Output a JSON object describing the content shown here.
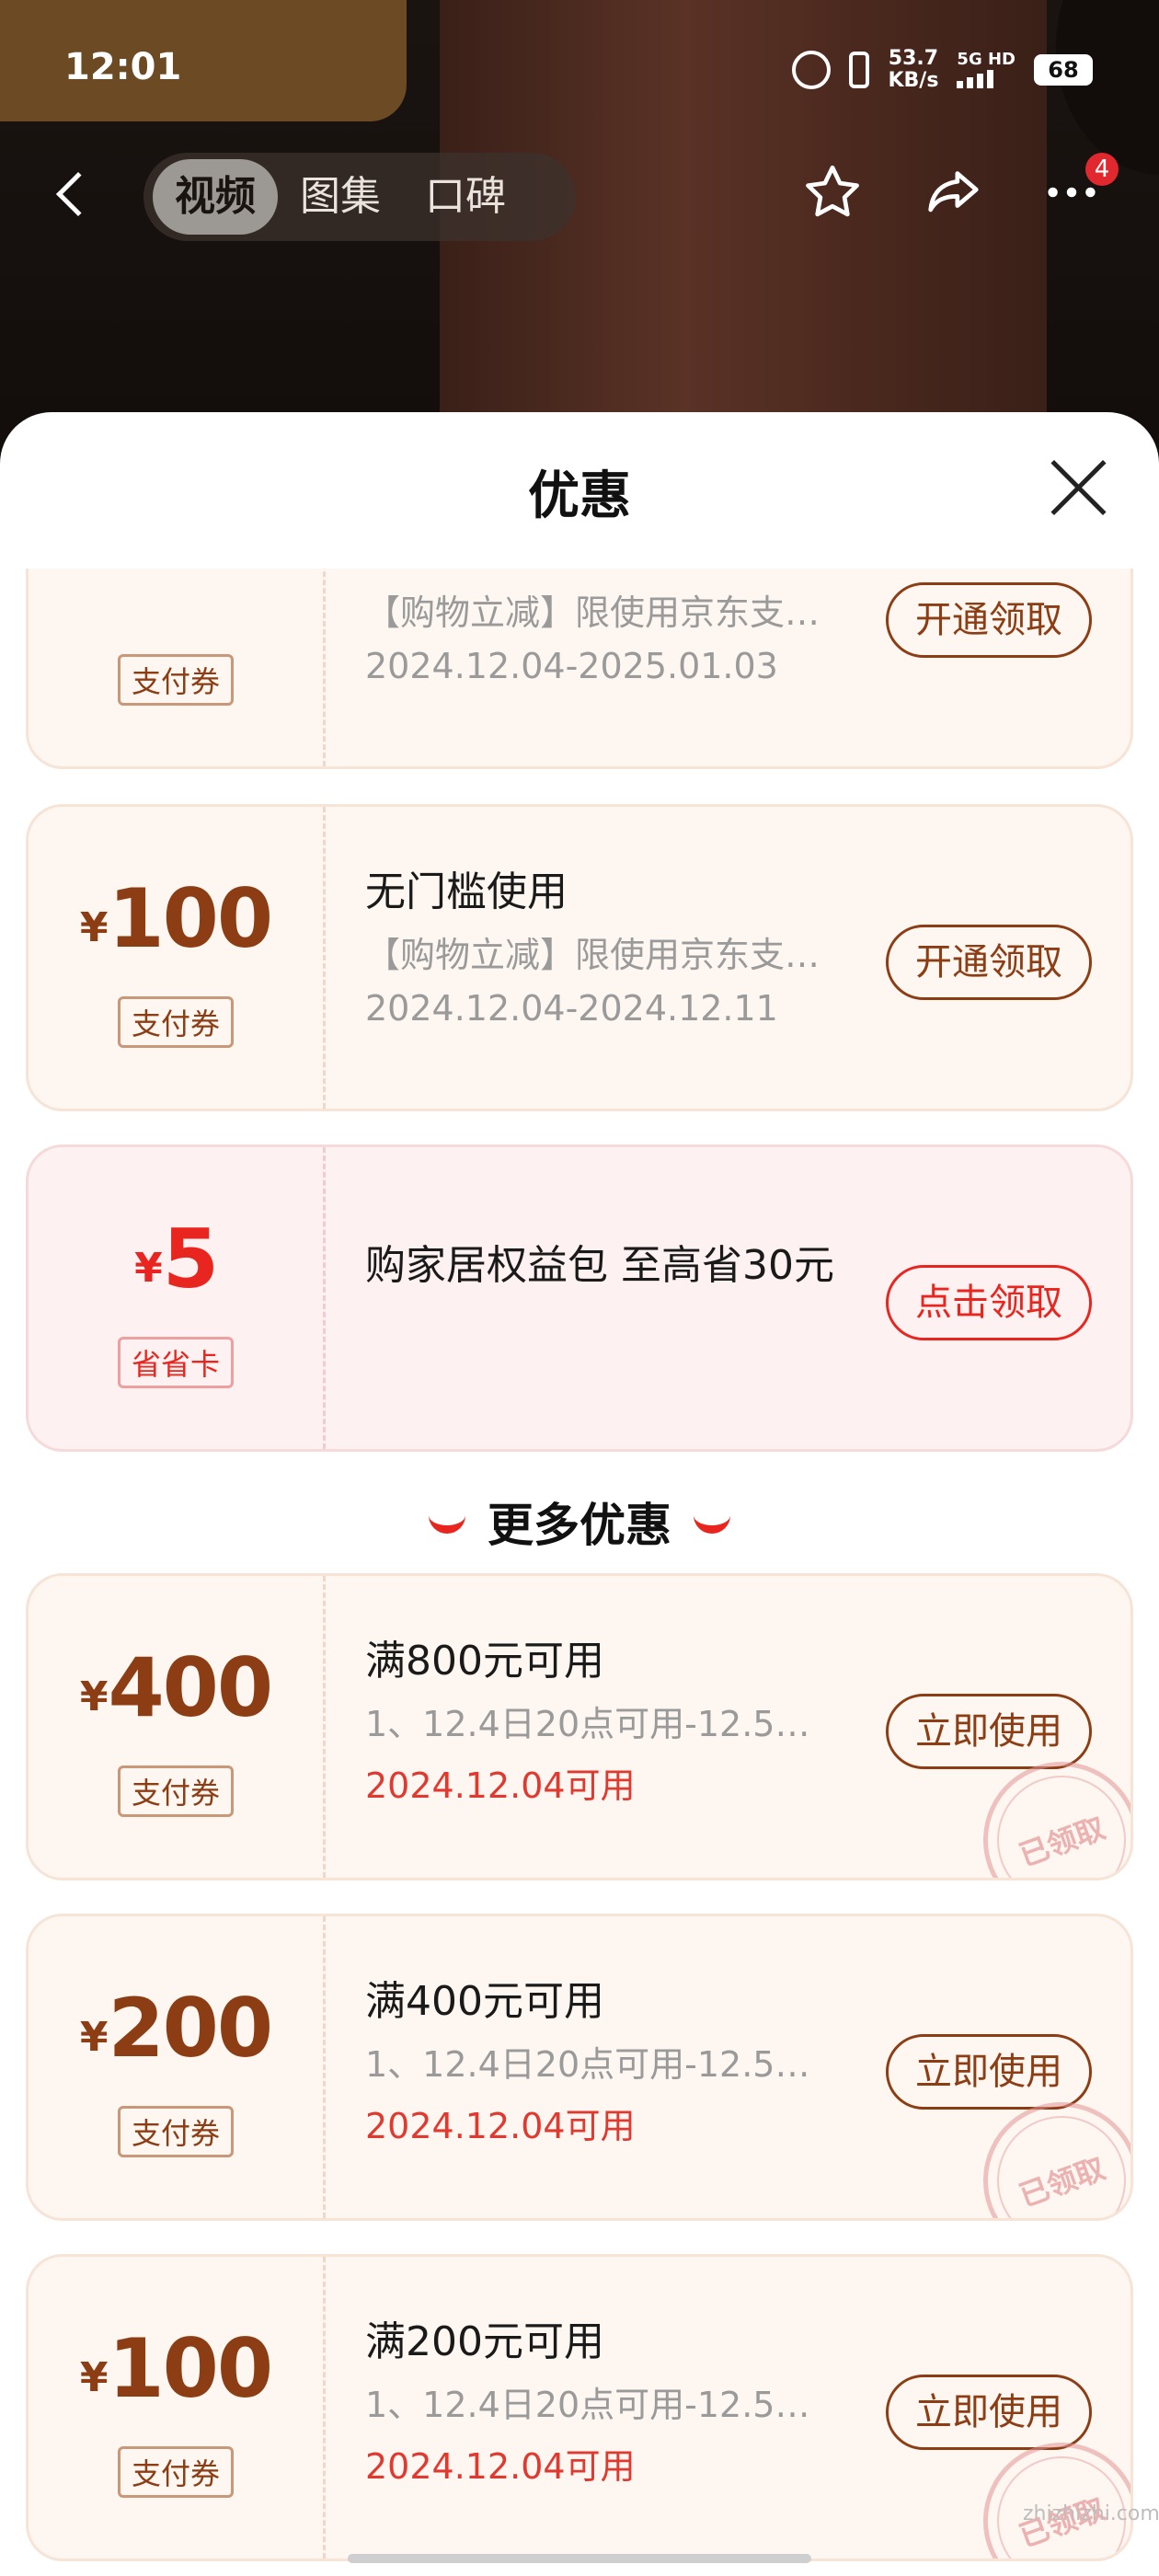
{
  "status_bar": {
    "time": "12:01",
    "net_speed": "53.7",
    "net_unit": "KB/s",
    "net_type": "5G HD",
    "battery": "68"
  },
  "nav": {
    "tabs": [
      {
        "label": "视频",
        "active": true
      },
      {
        "label": "图集",
        "active": false
      },
      {
        "label": "口碑",
        "active": false
      }
    ],
    "badge_count": "4"
  },
  "sheet": {
    "title": "优惠",
    "more_title": "更多优惠"
  },
  "coupons": [
    {
      "currency": "¥",
      "amount": "",
      "tag": "支付券",
      "line1": "",
      "line2": "【购物立减】限使用京东支…",
      "line3": "2024.12.04-2025.01.03",
      "button": "开通领取",
      "style": "normal",
      "claimed": false
    },
    {
      "currency": "¥",
      "amount": "100",
      "tag": "支付券",
      "line1": "无门槛使用",
      "line2": "【购物立减】限使用京东支…",
      "line3": "2024.12.04-2024.12.11",
      "button": "开通领取",
      "style": "normal",
      "claimed": false
    },
    {
      "currency": "¥",
      "amount": "5",
      "tag": "省省卡",
      "line1": "购家居权益包 至高省30元",
      "line2": "",
      "line3": "",
      "button": "点击领取",
      "style": "red",
      "claimed": false
    }
  ],
  "more_coupons": [
    {
      "currency": "¥",
      "amount": "400",
      "tag": "支付券",
      "line1": "满800元可用",
      "line2": "1、12.4日20点可用-12.5…",
      "line3": "2024.12.04可用",
      "button": "立即使用",
      "claimed": true,
      "stamp": "已领取"
    },
    {
      "currency": "¥",
      "amount": "200",
      "tag": "支付券",
      "line1": "满400元可用",
      "line2": "1、12.4日20点可用-12.5…",
      "line3": "2024.12.04可用",
      "button": "立即使用",
      "claimed": true,
      "stamp": "已领取"
    },
    {
      "currency": "¥",
      "amount": "100",
      "tag": "支付券",
      "line1": "满200元可用",
      "line2": "1、12.4日20点可用-12.5…",
      "line3": "2024.12.04可用",
      "button": "立即使用",
      "claimed": true,
      "stamp": "已领取"
    }
  ],
  "watermark": "zhizhizhi.com",
  "colors": {
    "accent_brown": "#8c3d14",
    "accent_red": "#e8251e",
    "card_bg": "#fdf6f1",
    "date_red": "#e03a30"
  }
}
